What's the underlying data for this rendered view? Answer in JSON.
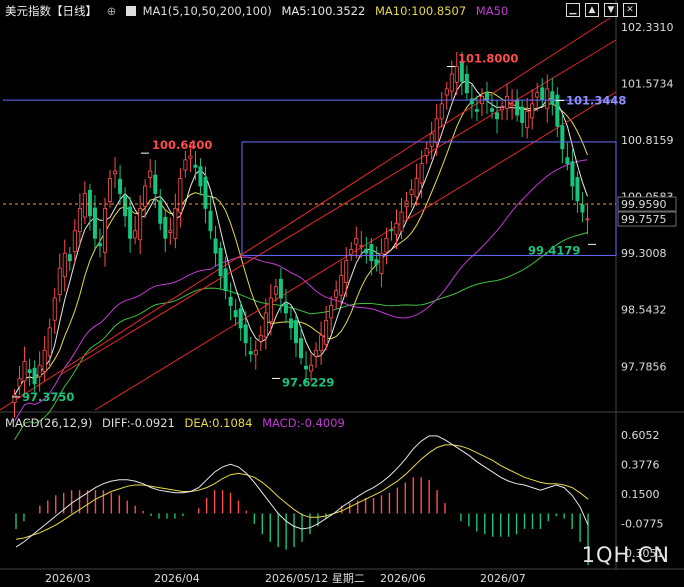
{
  "header": {
    "title": "美元指数【日线】",
    "ma_label": "MA1(5,10,50,200,100)",
    "ma5": "MA5:100.3522",
    "ma10": "MA10:100.8507",
    "ma50": "MA50"
  },
  "macd_header": {
    "label": "MACD(26,12,9)",
    "diff": "DIFF:-0.0921",
    "dea": "DEA:0.1084",
    "macd": "MACD:-0.4009"
  },
  "watermark": "1QH.CN",
  "colors": {
    "up": "#ff4d4d",
    "down": "#19c37d",
    "ma5": "#e8e8e8",
    "ma10": "#e6d84a",
    "ma50": "#c23bd4",
    "ma100": "#3fbf3f",
    "ma200": "#9a9a9a",
    "box": "#6b6bff",
    "channel": "#e02a2a",
    "price_line": "#ff9c33"
  },
  "chart_data": {
    "type": "candlestick",
    "price_ticks": [
      "102.3310",
      "101.5734",
      "100.8159",
      "100.0583",
      "99.9590",
      "99.7575",
      "99.3008",
      "98.5432",
      "97.7856"
    ],
    "macd_ticks": [
      "0.6052",
      "0.3776",
      "0.1500",
      "-0.0775",
      "-0.3051"
    ],
    "date_labels": [
      "2026/03",
      "2026/04",
      "2026/05/12 星期二",
      "2026/06",
      "2026/07"
    ],
    "annotations": [
      "100.6400",
      "101.8000",
      "101.3448",
      "97.3750",
      "97.6229",
      "99.4179"
    ],
    "current_price": 99.7575,
    "dashed_price": 99.959,
    "box": {
      "top": 100.79,
      "bottom": 99.27
    },
    "horizontal_line": 101.35,
    "ylim": [
      97.2,
      102.45
    ],
    "macd_ylim": [
      -0.36,
      0.63
    ],
    "closes": [
      97.4,
      97.62,
      97.85,
      97.7,
      97.55,
      97.8,
      98.0,
      98.3,
      98.7,
      99.1,
      99.3,
      99.2,
      99.6,
      99.9,
      100.1,
      99.8,
      99.5,
      99.4,
      99.9,
      100.3,
      100.4,
      100.1,
      99.8,
      99.5,
      99.6,
      99.9,
      100.2,
      100.4,
      100.1,
      99.7,
      99.5,
      99.6,
      99.9,
      100.3,
      100.55,
      100.6,
      100.45,
      100.2,
      99.9,
      99.6,
      99.3,
      99.0,
      98.8,
      98.6,
      98.45,
      98.3,
      98.1,
      97.95,
      98.0,
      98.2,
      98.5,
      98.7,
      98.85,
      98.7,
      98.5,
      98.3,
      98.1,
      97.9,
      97.75,
      97.8,
      98.0,
      98.2,
      98.4,
      98.6,
      98.8,
      99.0,
      99.2,
      99.35,
      99.5,
      99.4,
      99.3,
      99.2,
      99.15,
      99.3,
      99.5,
      99.6,
      99.7,
      99.85,
      100.0,
      100.15,
      100.3,
      100.5,
      100.7,
      100.9,
      101.1,
      101.3,
      101.5,
      101.7,
      101.8,
      101.6,
      101.45,
      101.3,
      101.2,
      101.4,
      101.35,
      101.2,
      101.1,
      101.25,
      101.4,
      101.3,
      101.15,
      101.05,
      101.2,
      101.3,
      101.45,
      101.35,
      101.5,
      101.3,
      101.0,
      100.7,
      100.5,
      100.2,
      100.0,
      99.85,
      99.76
    ],
    "macd_line": [
      -0.26,
      -0.22,
      -0.17,
      -0.12,
      -0.07,
      -0.02,
      0.03,
      0.08,
      0.12,
      0.16,
      0.2,
      0.23,
      0.25,
      0.26,
      0.26,
      0.25,
      0.23,
      0.2,
      0.18,
      0.17,
      0.16,
      0.16,
      0.17,
      0.2,
      0.26,
      0.32,
      0.36,
      0.38,
      0.36,
      0.31,
      0.24,
      0.16,
      0.08,
      0.0,
      -0.06,
      -0.1,
      -0.12,
      -0.11,
      -0.08,
      -0.04,
      0.0,
      0.05,
      0.09,
      0.13,
      0.17,
      0.2,
      0.24,
      0.29,
      0.35,
      0.42,
      0.5,
      0.56,
      0.6,
      0.6,
      0.57,
      0.53,
      0.49,
      0.45,
      0.4,
      0.36,
      0.32,
      0.28,
      0.25,
      0.23,
      0.22,
      0.2,
      0.18,
      0.2,
      0.22,
      0.2,
      0.14,
      0.05,
      -0.09
    ],
    "dea_line": [
      -0.2,
      -0.19,
      -0.17,
      -0.15,
      -0.12,
      -0.09,
      -0.05,
      -0.01,
      0.03,
      0.07,
      0.11,
      0.14,
      0.17,
      0.19,
      0.21,
      0.22,
      0.22,
      0.21,
      0.2,
      0.19,
      0.18,
      0.17,
      0.17,
      0.18,
      0.2,
      0.23,
      0.27,
      0.3,
      0.31,
      0.3,
      0.28,
      0.24,
      0.19,
      0.13,
      0.08,
      0.03,
      -0.01,
      -0.03,
      -0.03,
      -0.02,
      0.0,
      0.02,
      0.05,
      0.08,
      0.11,
      0.14,
      0.17,
      0.21,
      0.25,
      0.3,
      0.36,
      0.42,
      0.47,
      0.51,
      0.53,
      0.53,
      0.52,
      0.5,
      0.47,
      0.44,
      0.41,
      0.37,
      0.34,
      0.31,
      0.28,
      0.26,
      0.24,
      0.23,
      0.23,
      0.22,
      0.2,
      0.16,
      0.11
    ]
  }
}
